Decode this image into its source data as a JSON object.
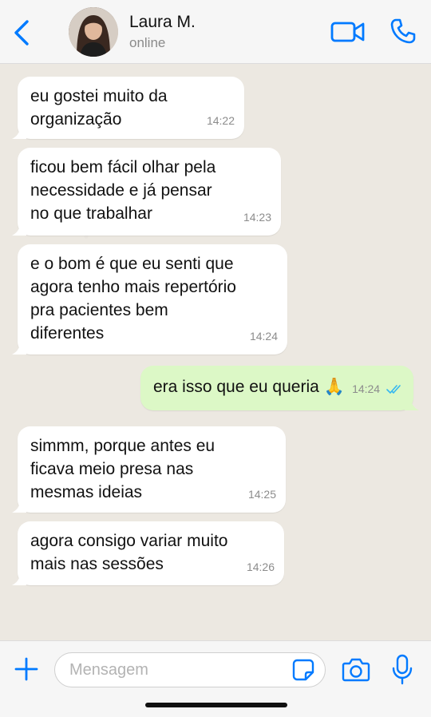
{
  "header": {
    "contact_name": "Laura M.",
    "status": "online"
  },
  "colors": {
    "accent": "#007aff",
    "incoming_bubble": "#ffffff",
    "outgoing_bubble": "#dcf8c6",
    "chat_background": "#ece8e1",
    "read_ticks": "#34b7f1"
  },
  "messages": [
    {
      "direction": "in",
      "text": "eu gostei muito da organização",
      "time": "14:22"
    },
    {
      "direction": "in",
      "text": "ficou bem fácil olhar pela necessidade e já pensar no que trabalhar",
      "time": "14:23"
    },
    {
      "direction": "in",
      "text": "e o bom é que eu senti que agora tenho mais repertório pra pacientes bem diferentes",
      "time": "14:24"
    },
    {
      "direction": "out",
      "text": "era isso que eu queria 🙏",
      "time": "14:24",
      "status": "read"
    },
    {
      "direction": "in",
      "text": "simmm, porque antes eu ficava meio presa nas mesmas ideias",
      "time": "14:25"
    },
    {
      "direction": "in",
      "text": "agora consigo variar muito mais nas sessões",
      "time": "14:26"
    }
  ],
  "composer": {
    "placeholder": "Mensagem",
    "value": ""
  },
  "icons": {
    "back": "chevron-left-icon",
    "video": "video-camera-icon",
    "call": "phone-icon",
    "attach": "plus-icon",
    "sticker": "sticker-icon",
    "camera": "camera-icon",
    "mic": "microphone-icon"
  }
}
